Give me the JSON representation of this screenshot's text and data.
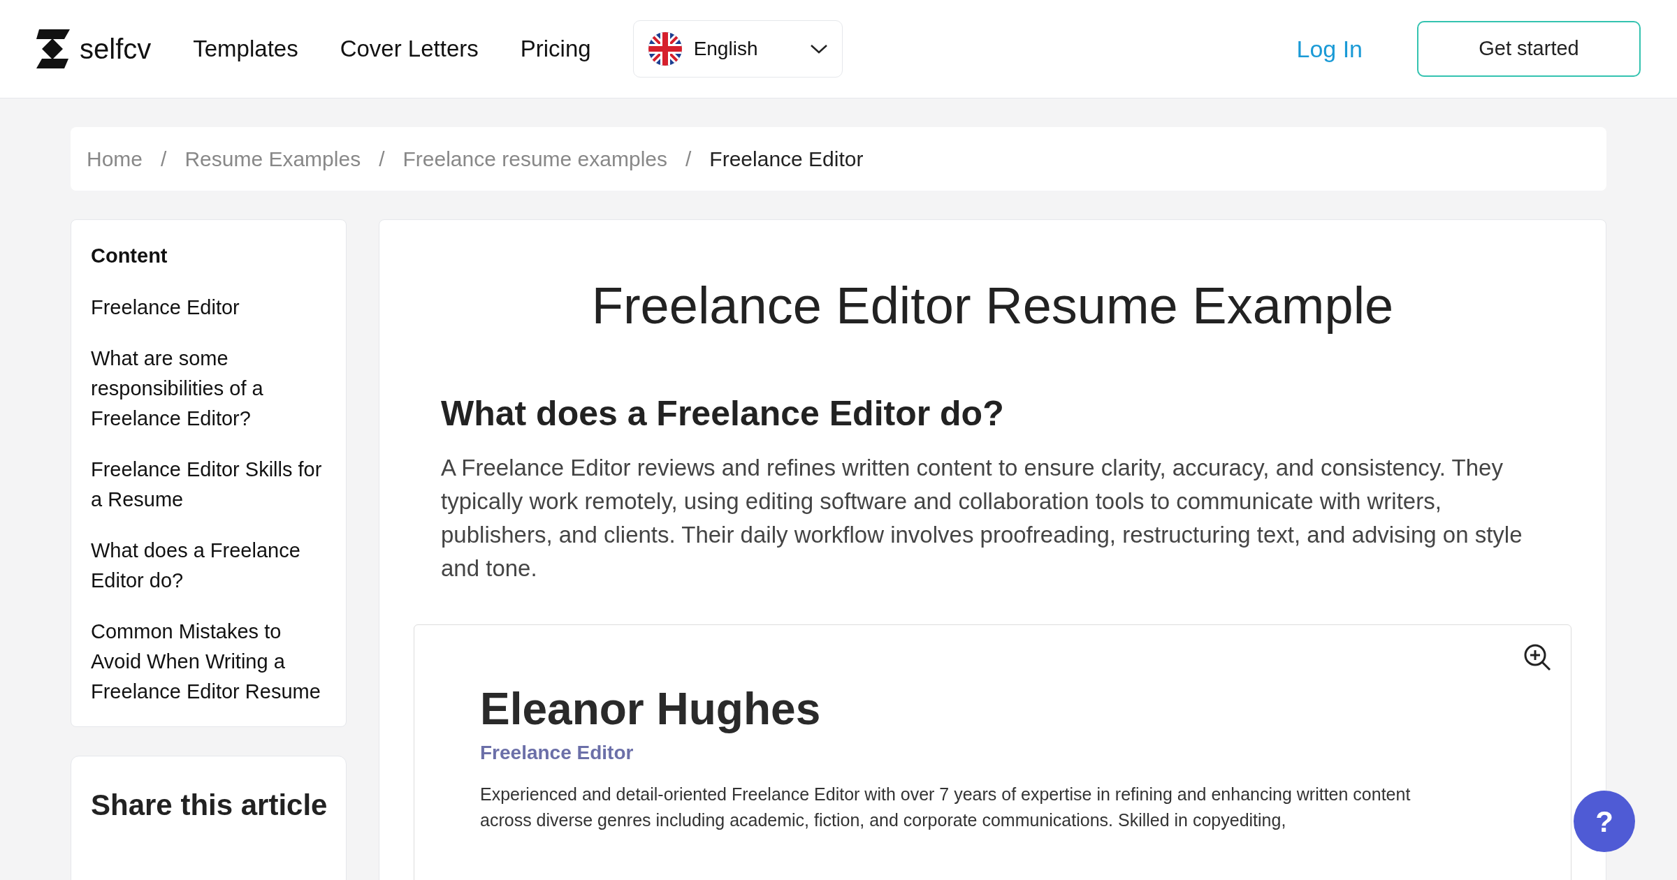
{
  "header": {
    "logo": "selfcv",
    "nav": [
      "Templates",
      "Cover Letters",
      "Pricing"
    ],
    "language": "English",
    "login": "Log In",
    "cta": "Get started"
  },
  "breadcrumb": {
    "separator": "/",
    "items": [
      "Home",
      "Resume Examples",
      "Freelance resume examples",
      "Freelance Editor"
    ]
  },
  "sidebar": {
    "title": "Content",
    "items": [
      "Freelance Editor",
      "What are some responsibilities of a Freelance Editor?",
      "Freelance Editor Skills for a Resume",
      "What does a Freelance Editor do?",
      "Common Mistakes to Avoid When Writing a Freelance Editor Resume"
    ]
  },
  "share": {
    "title": "Share this article"
  },
  "article": {
    "title": "Freelance Editor Resume Example",
    "heading": "What does a Freelance Editor do?",
    "paragraph": "A Freelance Editor reviews and refines written content to ensure clarity, accuracy, and consistency. They typically work remotely, using editing software and collaboration tools to communicate with writers, publishers, and clients. Their daily workflow involves proofreading, restructuring text, and advising on style and tone."
  },
  "resume": {
    "name": "Eleanor Hughes",
    "role": "Freelance Editor",
    "summary": "Experienced and detail-oriented Freelance Editor with over 7 years of expertise in refining and enhancing written content across diverse genres including academic, fiction, and corporate communications. Skilled in copyediting,"
  },
  "help": "?"
}
